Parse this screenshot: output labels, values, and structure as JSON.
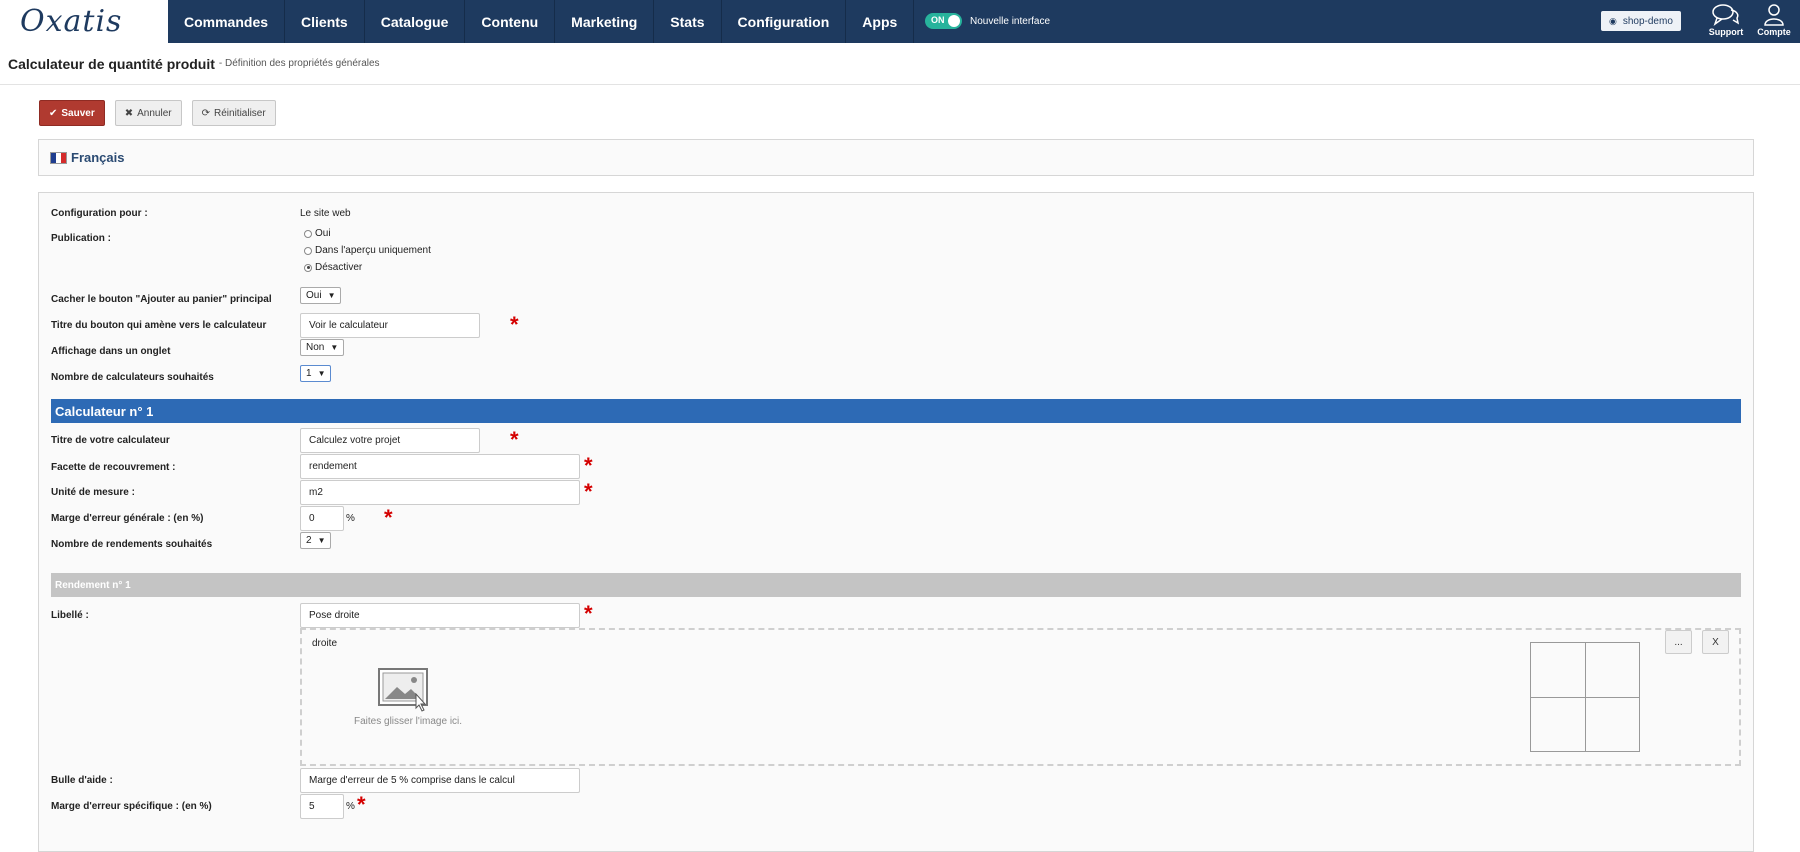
{
  "nav": {
    "logo": "Oxatis",
    "items": [
      "Commandes",
      "Clients",
      "Catalogue",
      "Contenu",
      "Marketing",
      "Stats",
      "Configuration",
      "Apps"
    ],
    "toggle_state": "ON",
    "toggle_label": "Nouvelle interface",
    "shop_button": "shop-demo",
    "support_label": "Support",
    "account_label": "Compte"
  },
  "header": {
    "title": "Calculateur de quantité produit",
    "subtitle": "- Définition des propriétés générales"
  },
  "actions": {
    "save": "Sauver",
    "cancel": "Annuler",
    "reset": "Réinitialiser"
  },
  "language": {
    "label": "Français"
  },
  "form": {
    "config_label": "Configuration pour :",
    "config_value": "Le site web",
    "publication_label": "Publication :",
    "publication_options": [
      "Oui",
      "Dans l'aperçu uniquement",
      "Désactiver"
    ],
    "publication_selected": "Désactiver",
    "hide_button_label": "Cacher le bouton \"Ajouter au panier\" principal",
    "hide_button_value": "Oui",
    "button_title_label": "Titre du bouton qui amène vers le calculateur",
    "button_title_value": "Voir le calculateur",
    "tab_display_label": "Affichage dans un onglet",
    "tab_display_value": "Non",
    "calc_count_label": "Nombre de calculateurs souhaités",
    "calc_count_value": "1"
  },
  "calculator": {
    "header": "Calculateur n° 1",
    "title_label": "Titre de votre calculateur",
    "title_value": "Calculez votre projet",
    "facet_label": "Facette de recouvrement :",
    "facet_value": "rendement",
    "unit_label": "Unité de mesure :",
    "unit_value": "m2",
    "margin_label": "Marge d'erreur générale : (en %)",
    "margin_value": "0",
    "yield_count_label": "Nombre de rendements souhaités",
    "yield_count_value": "2"
  },
  "yield": {
    "header": "Rendement n° 1",
    "label_label": "Libellé :",
    "label_value": "Pose droite",
    "image_name": "droite",
    "drop_hint": "Faites glisser l'image ici.",
    "browse_button": "...",
    "remove_button": "X",
    "tooltip_label": "Bulle d'aide :",
    "tooltip_value": "Marge d'erreur de 5 % comprise dans le calcul",
    "specific_margin_label": "Marge d'erreur spécifique : (en %)",
    "specific_margin_value": "5"
  },
  "symbols": {
    "required": "*",
    "percent": "%"
  },
  "colors": {
    "nav_bg": "#1e3a5f",
    "save": "#b03a30",
    "section": "#2d6ab5",
    "required": "#d40000"
  }
}
